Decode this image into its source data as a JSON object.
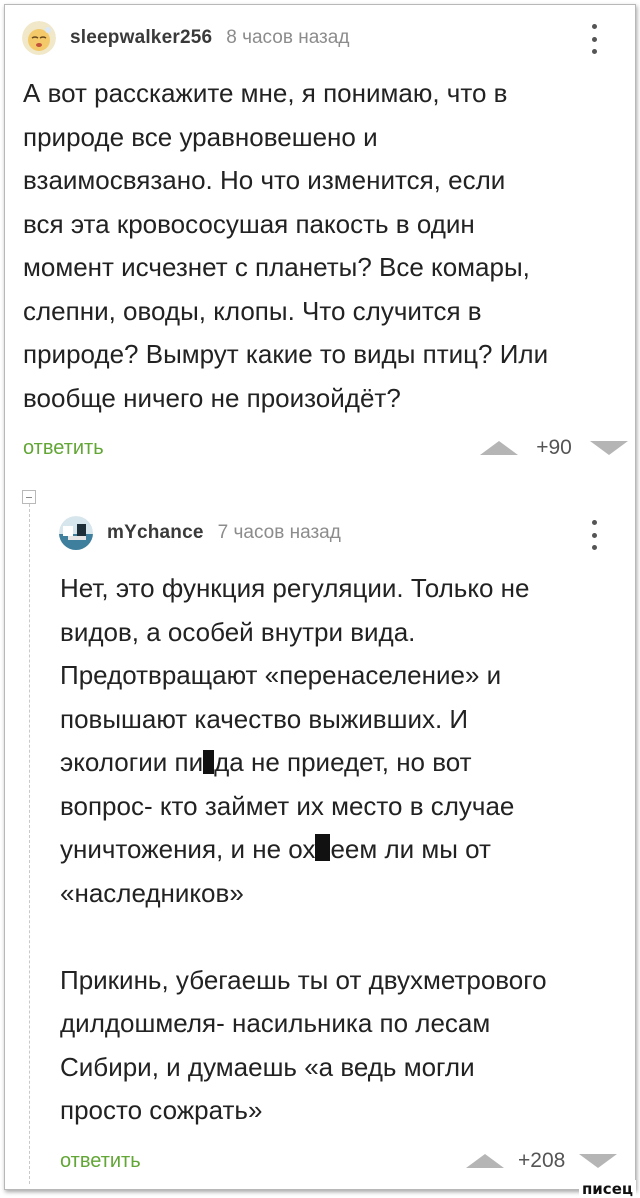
{
  "comments": [
    {
      "username": "sleepwalker256",
      "timestamp": "8 часов назад",
      "lines": [
        "А вот расскажите мне, я понимаю, что в",
        "природе все уравновешено и",
        "взаимосвязано. Но что изменится, если",
        "вся эта кровососушая пакость в один",
        "момент исчезнет с планеты? Все комары,",
        "слепни, оводы, клопы. Что случится в",
        "природе? Вымрут какие то виды птиц? Или",
        "вообще ничего не произойдёт?"
      ],
      "reply_label": "ответить",
      "rating": "+90"
    },
    {
      "username": "mYchance",
      "timestamp": "7 часов назад",
      "lines": [
        "Нет, это функция регуляции. Только не",
        "видов, а особей внутри вида.",
        "Предотвращают «перенаселение» и",
        "повышают качество выживших. И",
        "экологии пи",
        "да не приедет, но вот",
        "вопрос- кто займет их место в случае",
        "уничтожения, и не ох",
        "еем ли мы от",
        "«наследников»",
        "Прикинь, убегаешь ты от двухметрового",
        "дилдошмеля- насильника по лесам",
        "Сибири, и думаешь «а ведь могли",
        "просто сожрать»"
      ],
      "reply_label": "ответить",
      "rating": "+208"
    }
  ],
  "watermark": "писец",
  "colors": {
    "reply_link": "#62a636",
    "vote_arrow": "#b5b5b5",
    "timestamp": "#8c8c8c"
  }
}
